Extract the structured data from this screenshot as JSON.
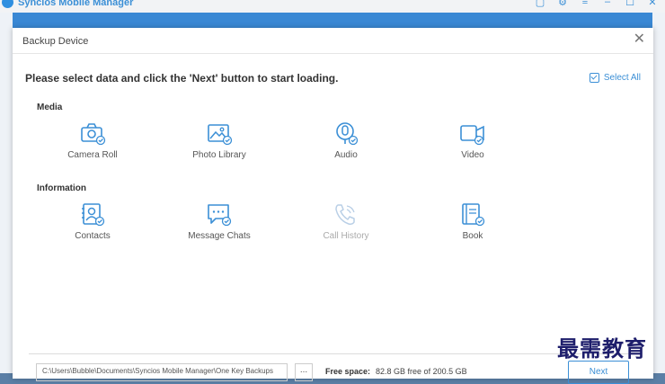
{
  "app": {
    "title": "Syncios Mobile Manager"
  },
  "titlebar_icons": [
    "chat-icon",
    "gear-icon",
    "menu-icon",
    "minimize-icon",
    "maximize-icon",
    "close-icon"
  ],
  "dialog": {
    "title": "Backup Device",
    "instruction": "Please select data and click the 'Next' button to start loading.",
    "select_all": "Select All",
    "sections": {
      "media": {
        "label": "Media",
        "items": [
          {
            "label": "Camera Roll",
            "icon": "camera-icon",
            "checked": true
          },
          {
            "label": "Photo Library",
            "icon": "photo-icon",
            "checked": true
          },
          {
            "label": "Audio",
            "icon": "microphone-icon",
            "checked": true
          },
          {
            "label": "Video",
            "icon": "video-icon",
            "checked": true
          }
        ]
      },
      "information": {
        "label": "Information",
        "items": [
          {
            "label": "Contacts",
            "icon": "contacts-icon",
            "checked": true
          },
          {
            "label": "Message Chats",
            "icon": "message-icon",
            "checked": true
          },
          {
            "label": "Call History",
            "icon": "phone-icon",
            "checked": false,
            "disabled": true
          },
          {
            "label": "Book",
            "icon": "book-icon",
            "checked": true
          }
        ]
      }
    },
    "footer": {
      "path": "C:\\Users\\Bubble\\Documents\\Syncios Mobile Manager\\One Key Backups",
      "browse": "...",
      "free_space_label": "Free space:",
      "free_space_value": "82.8 GB free of 200.5 GB",
      "next": "Next"
    }
  },
  "watermark": "最需教育",
  "colors": {
    "accent": "#3b8fd6",
    "header": "#3a88d4",
    "disabled": "#b9cfe6"
  }
}
